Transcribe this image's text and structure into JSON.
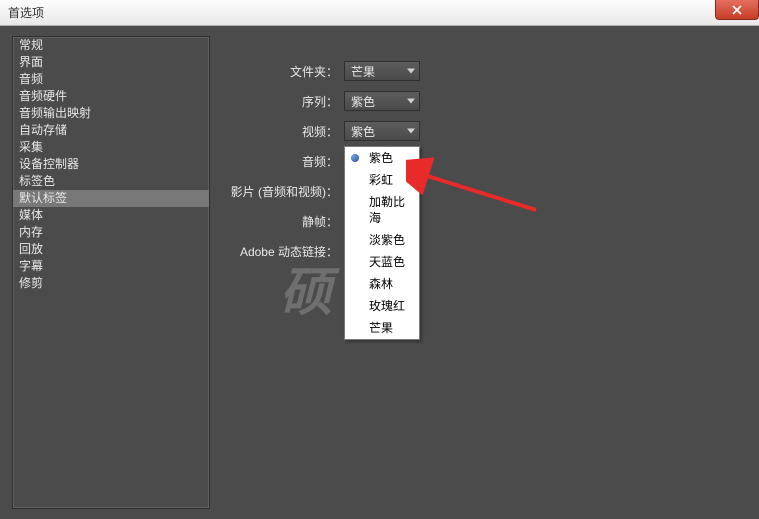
{
  "window": {
    "title": "首选项"
  },
  "sidebar": {
    "items": [
      {
        "label": "常规"
      },
      {
        "label": "界面"
      },
      {
        "label": "音频"
      },
      {
        "label": "音频硬件"
      },
      {
        "label": "音频输出映射"
      },
      {
        "label": "自动存储"
      },
      {
        "label": "采集"
      },
      {
        "label": "设备控制器"
      },
      {
        "label": "标签色"
      },
      {
        "label": "默认标签"
      },
      {
        "label": "媒体"
      },
      {
        "label": "内存"
      },
      {
        "label": "回放"
      },
      {
        "label": "字幕"
      },
      {
        "label": "修剪"
      }
    ],
    "selectedIndex": 9
  },
  "form": {
    "rows": [
      {
        "label": "文件夹：",
        "value": "芒果"
      },
      {
        "label": "序列：",
        "value": "紫色"
      },
      {
        "label": "视频：",
        "value": "紫色"
      },
      {
        "label": "音频：",
        "value": ""
      },
      {
        "label": "影片 (音频和视频)：",
        "value": ""
      },
      {
        "label": "静帧：",
        "value": ""
      },
      {
        "label": "Adobe 动态链接：",
        "value": ""
      }
    ]
  },
  "dropdown": {
    "selectedIndex": 0,
    "options": [
      {
        "label": "紫色"
      },
      {
        "label": "彩虹"
      },
      {
        "label": "加勒比海"
      },
      {
        "label": "淡紫色"
      },
      {
        "label": "天蓝色"
      },
      {
        "label": "森林"
      },
      {
        "label": "玫瑰红"
      },
      {
        "label": "芒果"
      }
    ]
  },
  "watermark": "硕    网"
}
